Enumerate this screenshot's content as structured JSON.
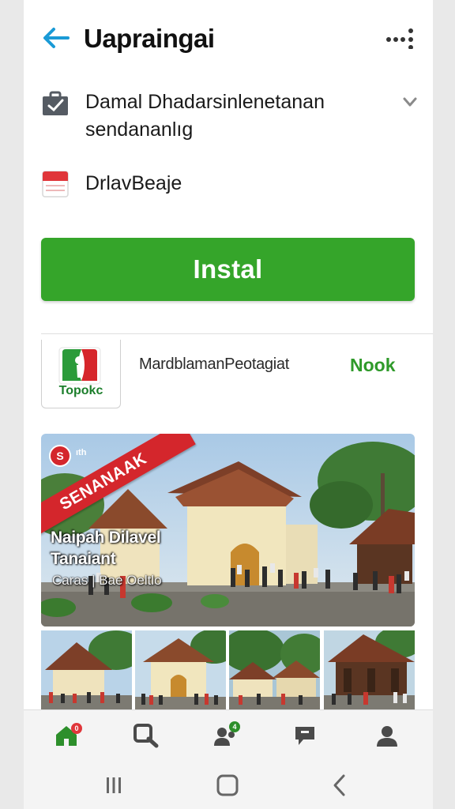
{
  "header": {
    "title": "Uapraingai",
    "back_icon": "arrow-left-icon",
    "menu_icon": "more-dots-icon"
  },
  "organization": {
    "name": "Damal Dhadarsinlenetanan sendananlıg",
    "icon": "briefcase-icon"
  },
  "date": {
    "text": "DrlavBeaje",
    "icon": "calendar-icon"
  },
  "install_button": {
    "label": "Instal"
  },
  "partner_app": {
    "logo_text": "Topokc",
    "name": "MardblamanPeotagiat",
    "action": "Nook"
  },
  "hero": {
    "ribbon": "SENANAAK",
    "badge": "S",
    "badge_text": "ıth",
    "title_line1": "Naipah Dilavel",
    "title_line2": "Tanaiant",
    "subtitle": "Caras | Bae Oeltlo"
  },
  "bottom_nav": {
    "home_badge": "0",
    "community_badge": "4",
    "items": [
      "home-icon",
      "search-icon",
      "community-icon",
      "chat-icon",
      "profile-icon"
    ]
  },
  "colors": {
    "accent": "#35a52a",
    "back_arrow": "#1a9ad6",
    "ribbon": "#d4262c"
  }
}
